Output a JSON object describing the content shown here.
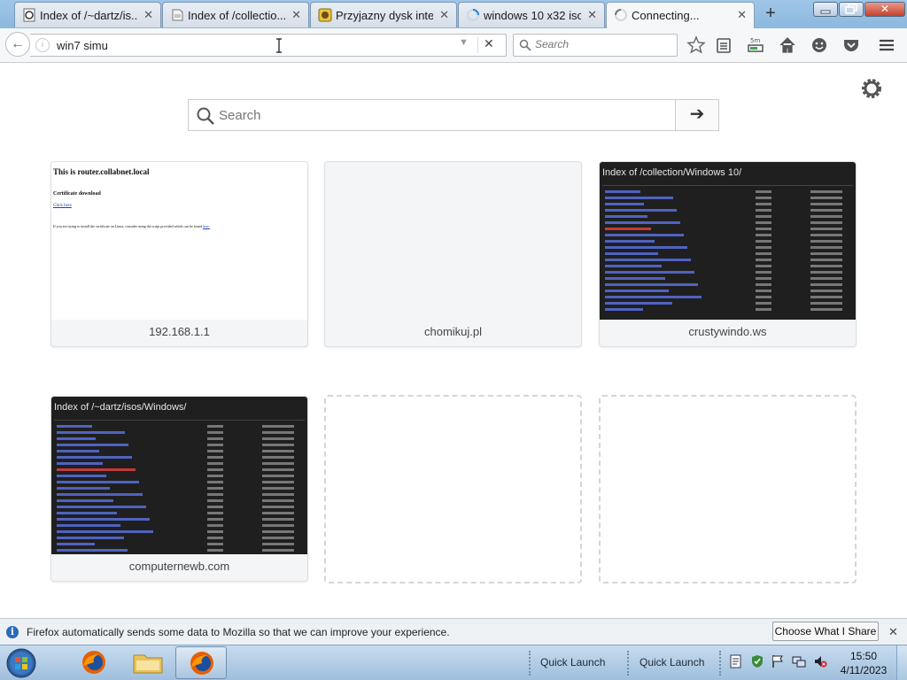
{
  "tabs": [
    {
      "label": "Index of /~dartz/is...",
      "icon": "document-icon"
    },
    {
      "label": "Index of /collectio...",
      "icon": "page-icon"
    },
    {
      "label": "Przyjazny dysk inte...",
      "icon": "chomikuj-icon"
    },
    {
      "label": "windows 10 x32 iso...",
      "icon": "loading-spinner-icon"
    },
    {
      "label": "Connecting...",
      "icon": "loading-spinner-icon"
    }
  ],
  "nav": {
    "url_value": "win7 simu",
    "search_placeholder": "Search"
  },
  "newtab_page": {
    "search_placeholder": "Search",
    "tiles": [
      {
        "label": "192.168.1.1",
        "thumb_type": "doc"
      },
      {
        "label": "chomikuj.pl",
        "thumb_type": "blank"
      },
      {
        "label": "crustywindo.ws",
        "thumb_type": "dark",
        "thumb_title": "Index of /collection/Windows 10/"
      },
      {
        "label": "computernewb.com",
        "thumb_type": "dark",
        "thumb_title": "Index of /~dartz/isos/Windows/"
      }
    ],
    "doc_thumb": {
      "heading": "This is router.collabnet.local",
      "sub": "Certificate download",
      "link": "Click here",
      "body": "If you are trying to install the certificate on Linux, consider using the script provided which can be found",
      "body_link": "here."
    }
  },
  "notification": {
    "text": "Firefox automatically sends some data to Mozilla so that we can improve your experience.",
    "button": "Choose What I Share"
  },
  "taskbar": {
    "quick_launch_1": "Quick Launch",
    "quick_launch_2": "Quick Launch",
    "time": "15:50",
    "date": "4/11/2023"
  }
}
